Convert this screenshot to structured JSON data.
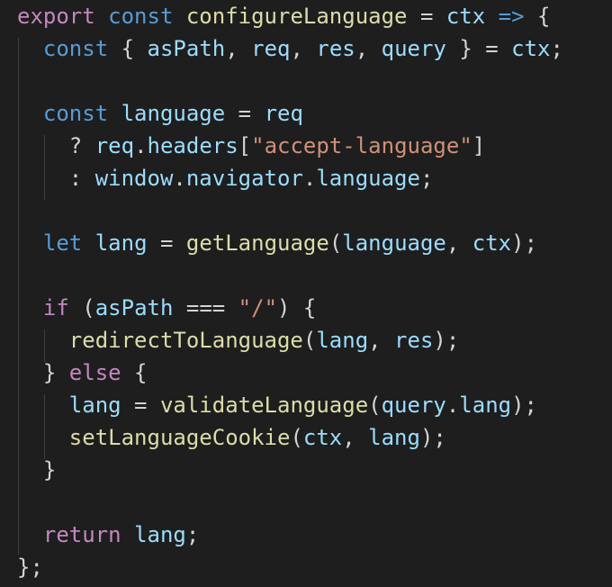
{
  "editor": {
    "colors": {
      "background": "#1e1e1e",
      "indent_guide": "#404040",
      "keyword": "#569cd6",
      "control": "#c586c0",
      "function": "#dcdcaa",
      "variable": "#9cdcfe",
      "string": "#ce9178",
      "plain": "#d4d4d4"
    },
    "lines": [
      [
        {
          "t": "export",
          "k": "ctl"
        },
        {
          "t": " ",
          "k": "pun"
        },
        {
          "t": "const",
          "k": "kw"
        },
        {
          "t": " ",
          "k": "pun"
        },
        {
          "t": "configureLanguage",
          "k": "fn"
        },
        {
          "t": " = ",
          "k": "op"
        },
        {
          "t": "ctx",
          "k": "var"
        },
        {
          "t": " ",
          "k": "pun"
        },
        {
          "t": "=>",
          "k": "kw"
        },
        {
          "t": " {",
          "k": "pun"
        }
      ],
      [
        {
          "t": "  ",
          "k": "pun"
        },
        {
          "t": "const",
          "k": "kw"
        },
        {
          "t": " { ",
          "k": "pun"
        },
        {
          "t": "asPath",
          "k": "var"
        },
        {
          "t": ", ",
          "k": "pun"
        },
        {
          "t": "req",
          "k": "var"
        },
        {
          "t": ", ",
          "k": "pun"
        },
        {
          "t": "res",
          "k": "var"
        },
        {
          "t": ", ",
          "k": "pun"
        },
        {
          "t": "query",
          "k": "var"
        },
        {
          "t": " } = ",
          "k": "pun"
        },
        {
          "t": "ctx",
          "k": "var"
        },
        {
          "t": ";",
          "k": "pun"
        }
      ],
      [],
      [
        {
          "t": "  ",
          "k": "pun"
        },
        {
          "t": "const",
          "k": "kw"
        },
        {
          "t": " ",
          "k": "pun"
        },
        {
          "t": "language",
          "k": "var"
        },
        {
          "t": " = ",
          "k": "op"
        },
        {
          "t": "req",
          "k": "var"
        }
      ],
      [
        {
          "t": "    ? ",
          "k": "op"
        },
        {
          "t": "req",
          "k": "var"
        },
        {
          "t": ".",
          "k": "pun"
        },
        {
          "t": "headers",
          "k": "var"
        },
        {
          "t": "[",
          "k": "pun"
        },
        {
          "t": "\"accept-language\"",
          "k": "str"
        },
        {
          "t": "]",
          "k": "pun"
        }
      ],
      [
        {
          "t": "    : ",
          "k": "op"
        },
        {
          "t": "window",
          "k": "var"
        },
        {
          "t": ".",
          "k": "pun"
        },
        {
          "t": "navigator",
          "k": "var"
        },
        {
          "t": ".",
          "k": "pun"
        },
        {
          "t": "language",
          "k": "var"
        },
        {
          "t": ";",
          "k": "pun"
        }
      ],
      [],
      [
        {
          "t": "  ",
          "k": "pun"
        },
        {
          "t": "let",
          "k": "kw"
        },
        {
          "t": " ",
          "k": "pun"
        },
        {
          "t": "lang",
          "k": "var"
        },
        {
          "t": " = ",
          "k": "op"
        },
        {
          "t": "getLanguage",
          "k": "fn"
        },
        {
          "t": "(",
          "k": "pun"
        },
        {
          "t": "language",
          "k": "var"
        },
        {
          "t": ", ",
          "k": "pun"
        },
        {
          "t": "ctx",
          "k": "var"
        },
        {
          "t": ");",
          "k": "pun"
        }
      ],
      [],
      [
        {
          "t": "  ",
          "k": "pun"
        },
        {
          "t": "if",
          "k": "ctl"
        },
        {
          "t": " (",
          "k": "pun"
        },
        {
          "t": "asPath",
          "k": "var"
        },
        {
          "t": " === ",
          "k": "op"
        },
        {
          "t": "\"/\"",
          "k": "str"
        },
        {
          "t": ") {",
          "k": "pun"
        }
      ],
      [
        {
          "t": "    ",
          "k": "pun"
        },
        {
          "t": "redirectToLanguage",
          "k": "fn"
        },
        {
          "t": "(",
          "k": "pun"
        },
        {
          "t": "lang",
          "k": "var"
        },
        {
          "t": ", ",
          "k": "pun"
        },
        {
          "t": "res",
          "k": "var"
        },
        {
          "t": ");",
          "k": "pun"
        }
      ],
      [
        {
          "t": "  } ",
          "k": "pun"
        },
        {
          "t": "else",
          "k": "ctl"
        },
        {
          "t": " {",
          "k": "pun"
        }
      ],
      [
        {
          "t": "    ",
          "k": "pun"
        },
        {
          "t": "lang",
          "k": "var"
        },
        {
          "t": " = ",
          "k": "op"
        },
        {
          "t": "validateLanguage",
          "k": "fn"
        },
        {
          "t": "(",
          "k": "pun"
        },
        {
          "t": "query",
          "k": "var"
        },
        {
          "t": ".",
          "k": "pun"
        },
        {
          "t": "lang",
          "k": "var"
        },
        {
          "t": ");",
          "k": "pun"
        }
      ],
      [
        {
          "t": "    ",
          "k": "pun"
        },
        {
          "t": "setLanguageCookie",
          "k": "fn"
        },
        {
          "t": "(",
          "k": "pun"
        },
        {
          "t": "ctx",
          "k": "var"
        },
        {
          "t": ", ",
          "k": "pun"
        },
        {
          "t": "lang",
          "k": "var"
        },
        {
          "t": ");",
          "k": "pun"
        }
      ],
      [
        {
          "t": "  }",
          "k": "pun"
        }
      ],
      [],
      [
        {
          "t": "  ",
          "k": "pun"
        },
        {
          "t": "return",
          "k": "ctl"
        },
        {
          "t": " ",
          "k": "pun"
        },
        {
          "t": "lang",
          "k": "var"
        },
        {
          "t": ";",
          "k": "pun"
        }
      ],
      [
        {
          "t": "};",
          "k": "pun"
        }
      ]
    ]
  }
}
